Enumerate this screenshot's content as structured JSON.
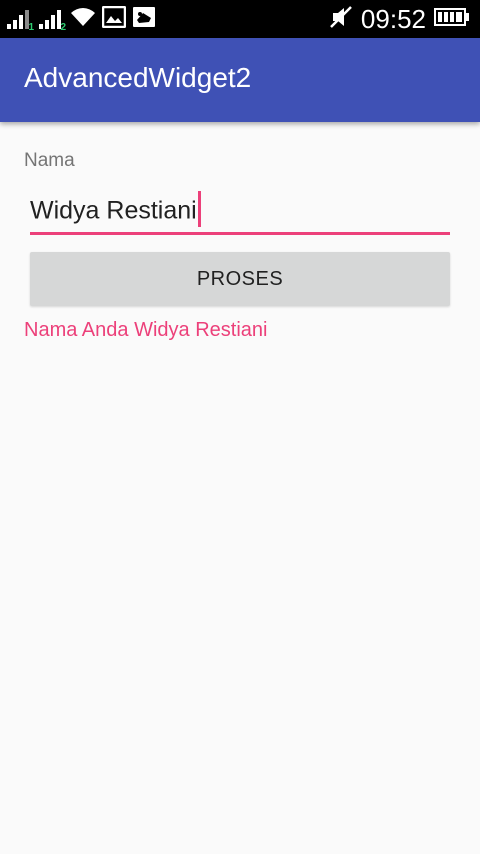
{
  "status_bar": {
    "time": "09:52",
    "sim1_label": "1",
    "sim2_label": "2",
    "icons": [
      "signal-icon",
      "signal-icon",
      "wifi-icon",
      "image-icon",
      "image-icon",
      "mute-icon",
      "battery-icon"
    ]
  },
  "app_bar": {
    "title": "AdvancedWidget2"
  },
  "form": {
    "label": "Nama",
    "input_value": "Widya Restiani",
    "button_label": "PROSES",
    "result_text": "Nama Anda Widya Restiani"
  },
  "colors": {
    "primary": "#3f51b5",
    "accent": "#ec407a",
    "background": "#fafafa",
    "button": "#d6d7d7"
  }
}
